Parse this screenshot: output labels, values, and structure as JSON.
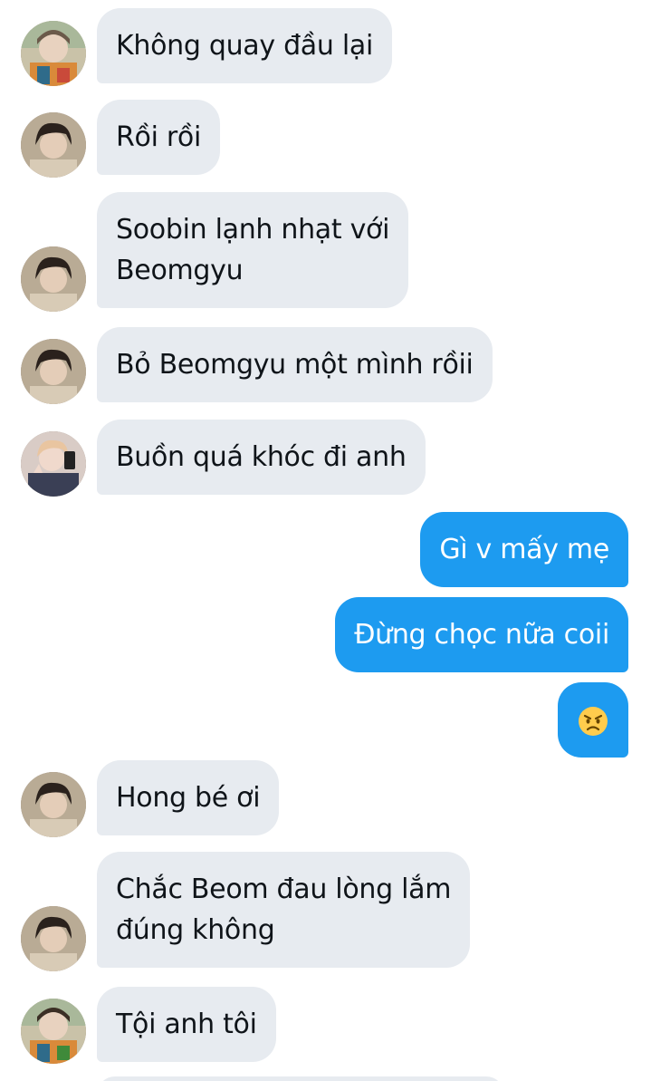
{
  "messages": [
    {
      "sender": "them",
      "avatar": "avatar-a",
      "text": "Không quay đầu lại"
    },
    {
      "sender": "them",
      "avatar": "avatar-b",
      "text": "Rồi rồi"
    },
    {
      "sender": "them",
      "avatar": "avatar-b",
      "text": "Soobin lạnh nhạt với Beomgyu",
      "line1": "Soobin lạnh nhạt với",
      "line2": "Beomgyu"
    },
    {
      "sender": "them",
      "avatar": "avatar-b",
      "text": "Bỏ Beomgyu một mình rồii"
    },
    {
      "sender": "them",
      "avatar": "avatar-c",
      "text": "Buồn quá khóc đi anh"
    },
    {
      "sender": "me",
      "text": "Gì v mấy mẹ"
    },
    {
      "sender": "me",
      "text": "Đừng chọc nữa coii"
    },
    {
      "sender": "me",
      "emoji": "angry-face"
    },
    {
      "sender": "them",
      "avatar": "avatar-b",
      "text": "Hong bé ơi"
    },
    {
      "sender": "them",
      "avatar": "avatar-b",
      "text": "Chắc Beom đau lòng lắm đúng không",
      "line1": "Chắc Beom đau lòng lắm",
      "line2": "đúng không"
    },
    {
      "sender": "them",
      "avatar": "avatar-a",
      "text": "Tội anh tôi"
    }
  ],
  "colors": {
    "incoming_bubble": "#e7ebf0",
    "outgoing_bubble": "#1d9bf0",
    "incoming_text": "#0f1419",
    "outgoing_text": "#ffffff"
  }
}
